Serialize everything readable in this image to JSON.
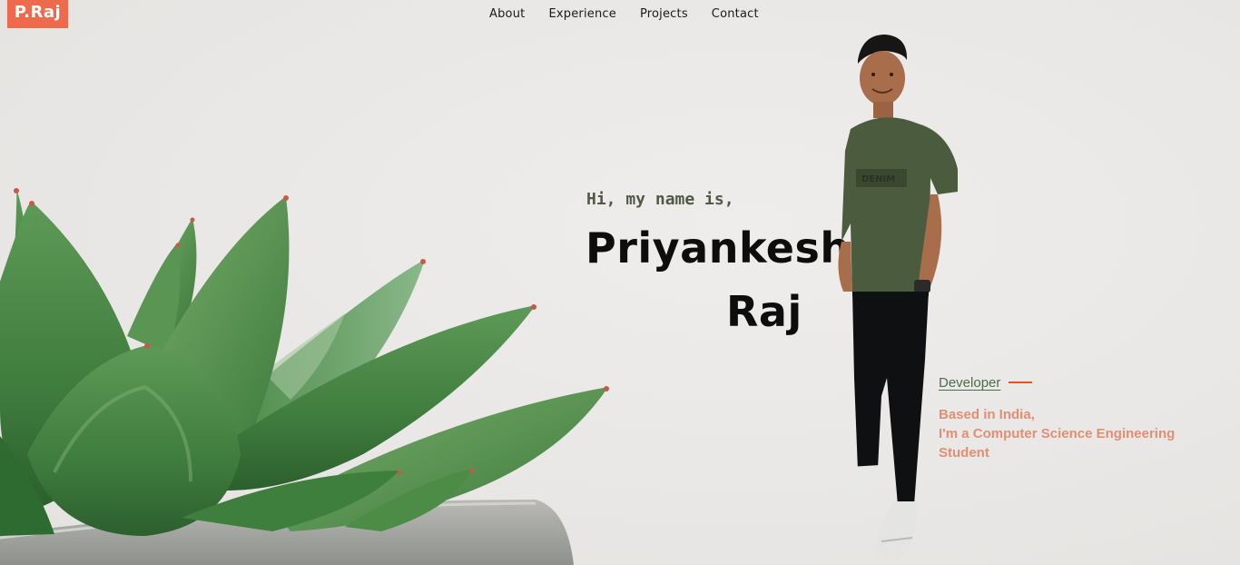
{
  "brand": {
    "logo_text": "P.Raj",
    "accent_color": "#ee6a4d"
  },
  "nav": {
    "items": [
      {
        "label": "About"
      },
      {
        "label": "Experience"
      },
      {
        "label": "Projects"
      },
      {
        "label": "Contact"
      }
    ]
  },
  "hero": {
    "greeting": "Hi, my name is,",
    "first_name": "Priyankesh",
    "last_name": "Raj",
    "role": "Developer",
    "role_line_color": "#e8541f",
    "bio_lines": [
      "Based in India,",
      "I'm a Computer Science Engineering",
      "Student"
    ]
  },
  "images": {
    "plant": "succulent-plant-icon",
    "portrait": "person-portrait-icon"
  }
}
